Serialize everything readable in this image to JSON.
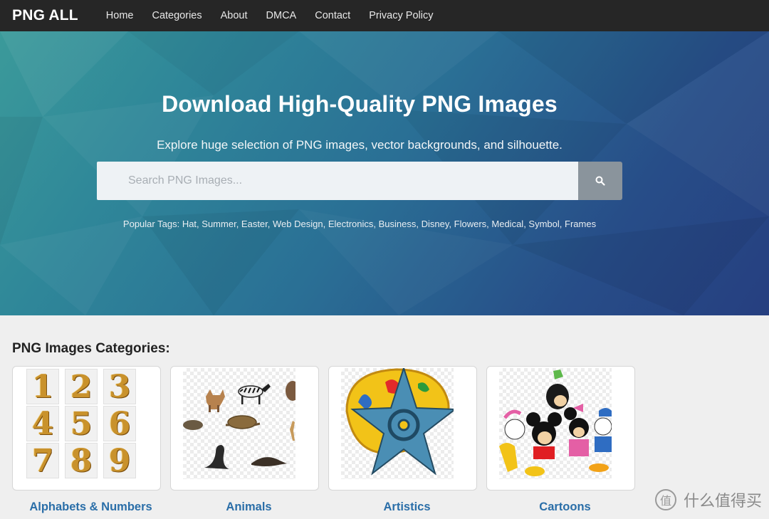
{
  "nav": {
    "brand": "PNG ALL",
    "links": [
      "Home",
      "Categories",
      "About",
      "DMCA",
      "Contact",
      "Privacy Policy"
    ]
  },
  "hero": {
    "title": "Download High-Quality PNG Images",
    "subtitle": "Explore huge selection of PNG images, vector backgrounds, and silhouette.",
    "search_placeholder": "Search PNG Images...",
    "search_icon": "search-icon",
    "tags_label": "Popular Tags:",
    "tags": [
      "Hat",
      "Summer",
      "Easter",
      "Web Design",
      "Electronics",
      "Business",
      "Disney",
      "Flowers",
      "Medical",
      "Symbol",
      "Frames"
    ]
  },
  "categories": {
    "title": "PNG Images Categories:",
    "numbers": [
      "1",
      "2",
      "3",
      "4",
      "5",
      "6",
      "7",
      "8",
      "9"
    ],
    "items": [
      {
        "label": "Alphabets & Numbers"
      },
      {
        "label": "Animals"
      },
      {
        "label": "Artistics"
      },
      {
        "label": "Cartoons"
      }
    ]
  },
  "watermark": {
    "text": "什么值得买"
  },
  "colors": {
    "navbar": "#262626",
    "hero_start": "#3b9a9a",
    "hero_end": "#263f80",
    "link": "#2a6ea8",
    "background": "#efefef"
  }
}
